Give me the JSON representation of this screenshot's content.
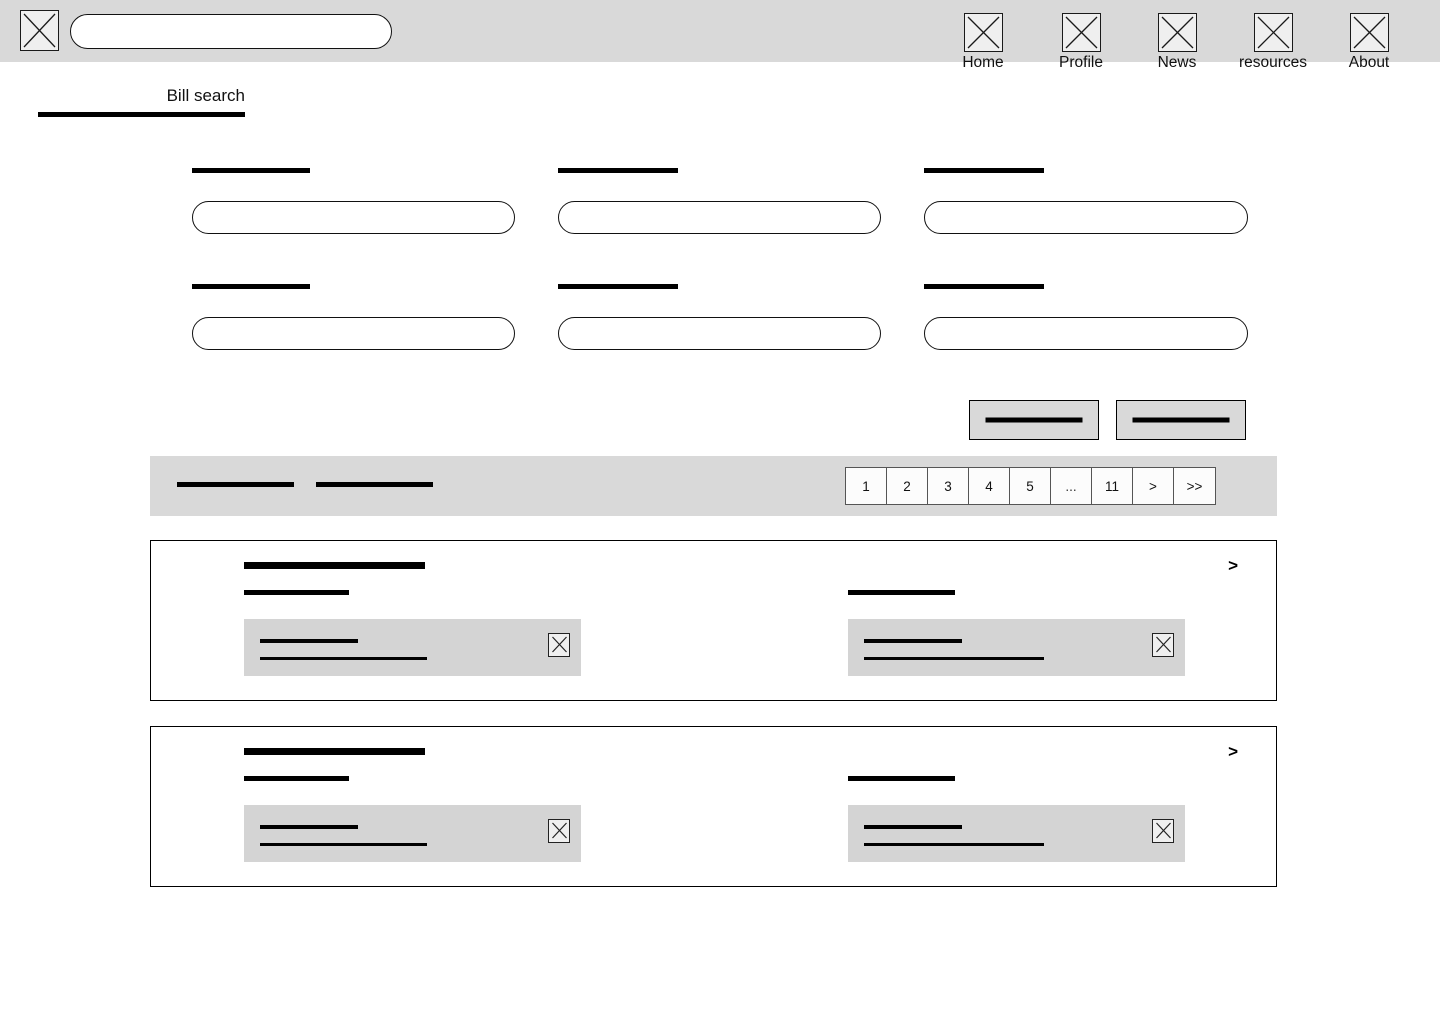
{
  "header": {
    "logo_icon": "x-box-icon",
    "search": {
      "value": "",
      "placeholder": ""
    },
    "nav": [
      {
        "label": "Home",
        "icon": "x-box-icon"
      },
      {
        "label": "Profile",
        "icon": "x-box-icon"
      },
      {
        "label": "News",
        "icon": "x-box-icon"
      },
      {
        "label": "resources",
        "icon": "x-box-icon"
      },
      {
        "label": "About",
        "icon": "x-box-icon"
      }
    ]
  },
  "tab": {
    "label": "Bill search",
    "active": true
  },
  "form": {
    "fields": [
      {
        "label_placeholder": "",
        "value": "",
        "placeholder": ""
      },
      {
        "label_placeholder": "",
        "value": "",
        "placeholder": ""
      },
      {
        "label_placeholder": "",
        "value": "",
        "placeholder": ""
      },
      {
        "label_placeholder": "",
        "value": "",
        "placeholder": ""
      },
      {
        "label_placeholder": "",
        "value": "",
        "placeholder": ""
      },
      {
        "label_placeholder": "",
        "value": "",
        "placeholder": ""
      }
    ],
    "buttons": [
      {
        "label_placeholder": ""
      },
      {
        "label_placeholder": ""
      }
    ]
  },
  "results": {
    "summary": [
      {
        "label_placeholder": ""
      },
      {
        "label_placeholder": ""
      }
    ],
    "pagination": {
      "current": "1",
      "pages": [
        "1",
        "2",
        "3",
        "4",
        "5"
      ],
      "ellipsis": "...",
      "last_page": "11",
      "next": ">",
      "jump_last": ">>"
    },
    "cards": [
      {
        "title_placeholder": "",
        "subtitle_placeholder": "",
        "right_label_placeholder": "",
        "expand": ">",
        "panels": [
          {
            "heading_placeholder": "",
            "detail_placeholder": "",
            "close_icon": "x-box-icon"
          },
          {
            "heading_placeholder": "",
            "detail_placeholder": "",
            "close_icon": "x-box-icon"
          }
        ]
      },
      {
        "title_placeholder": "",
        "subtitle_placeholder": "",
        "right_label_placeholder": "",
        "expand": ">",
        "panels": [
          {
            "heading_placeholder": "",
            "detail_placeholder": "",
            "close_icon": "x-box-icon"
          },
          {
            "heading_placeholder": "",
            "detail_placeholder": "",
            "close_icon": "x-box-icon"
          }
        ]
      }
    ]
  },
  "colors": {
    "header_bg": "#d9d9d9",
    "panel_bg": "#d4d4d4",
    "icon_bg": "#efefef",
    "stroke": "#000000",
    "page_bg": "#ffffff"
  }
}
